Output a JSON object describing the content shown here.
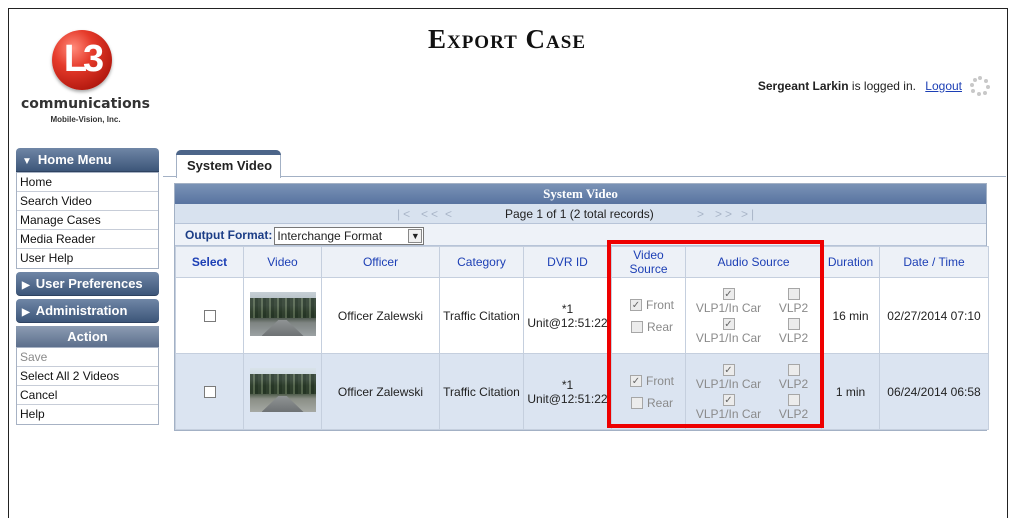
{
  "page": {
    "title": "Export Case"
  },
  "logo": {
    "mark": "L3",
    "name": "communications",
    "sub": "Mobile-Vision, Inc."
  },
  "login": {
    "user": "Sergeant Larkin",
    "suffix": "is logged in.",
    "logout": "Logout"
  },
  "sidebar": {
    "home_menu": {
      "label": "Home Menu",
      "items": [
        {
          "label": "Home"
        },
        {
          "label": "Search Video"
        },
        {
          "label": "Manage Cases"
        },
        {
          "label": "Media Reader"
        },
        {
          "label": "User Help"
        }
      ]
    },
    "user_prefs": {
      "label": "User Preferences"
    },
    "administration": {
      "label": "Administration"
    },
    "action": {
      "label": "Action",
      "items": [
        {
          "label": "Save",
          "disabled": true
        },
        {
          "label": "Select All 2 Videos"
        },
        {
          "label": "Cancel"
        },
        {
          "label": "Help"
        }
      ]
    }
  },
  "tab": {
    "label": "System Video"
  },
  "grid": {
    "title": "System Video",
    "pager": {
      "first": "|<",
      "prev_page": "<<",
      "prev": "<",
      "info": "Page 1 of 1 (2 total records)",
      "next": ">",
      "next_page": ">>",
      "last": ">|"
    },
    "output_format": {
      "label": "Output Format:",
      "value": "Interchange Format"
    },
    "columns": [
      "Select",
      "Video",
      "Officer",
      "Category",
      "DVR ID",
      "Video Source",
      "Audio Source",
      "Duration",
      "Date / Time"
    ],
    "rows": [
      {
        "officer": "Officer Zalewski",
        "category": "Traffic Citation",
        "dvr_line1": "*1",
        "dvr_line2": "Unit@12:51:22",
        "video_front": "Front",
        "video_rear": "Rear",
        "front_checked": true,
        "rear_checked": false,
        "audio": [
          "VLP1/In Car",
          "VLP2",
          "VLP1/In Car",
          "VLP2"
        ],
        "audio_checked": [
          true,
          false,
          true,
          false
        ],
        "duration": "16 min",
        "datetime": "02/27/2014 07:10"
      },
      {
        "officer": "Officer Zalewski",
        "category": "Traffic Citation",
        "dvr_line1": "*1",
        "dvr_line2": "Unit@12:51:22",
        "video_front": "Front",
        "video_rear": "Rear",
        "front_checked": true,
        "rear_checked": false,
        "audio": [
          "VLP1/In Car",
          "VLP2",
          "VLP1/In Car",
          "VLP2"
        ],
        "audio_checked": [
          true,
          false,
          true,
          false
        ],
        "duration": "1 min",
        "datetime": "06/24/2014 06:58"
      }
    ]
  },
  "colors": {
    "header_blue": "#4c6589",
    "link_blue": "#1c3fb5",
    "highlight_red": "#e00000"
  }
}
